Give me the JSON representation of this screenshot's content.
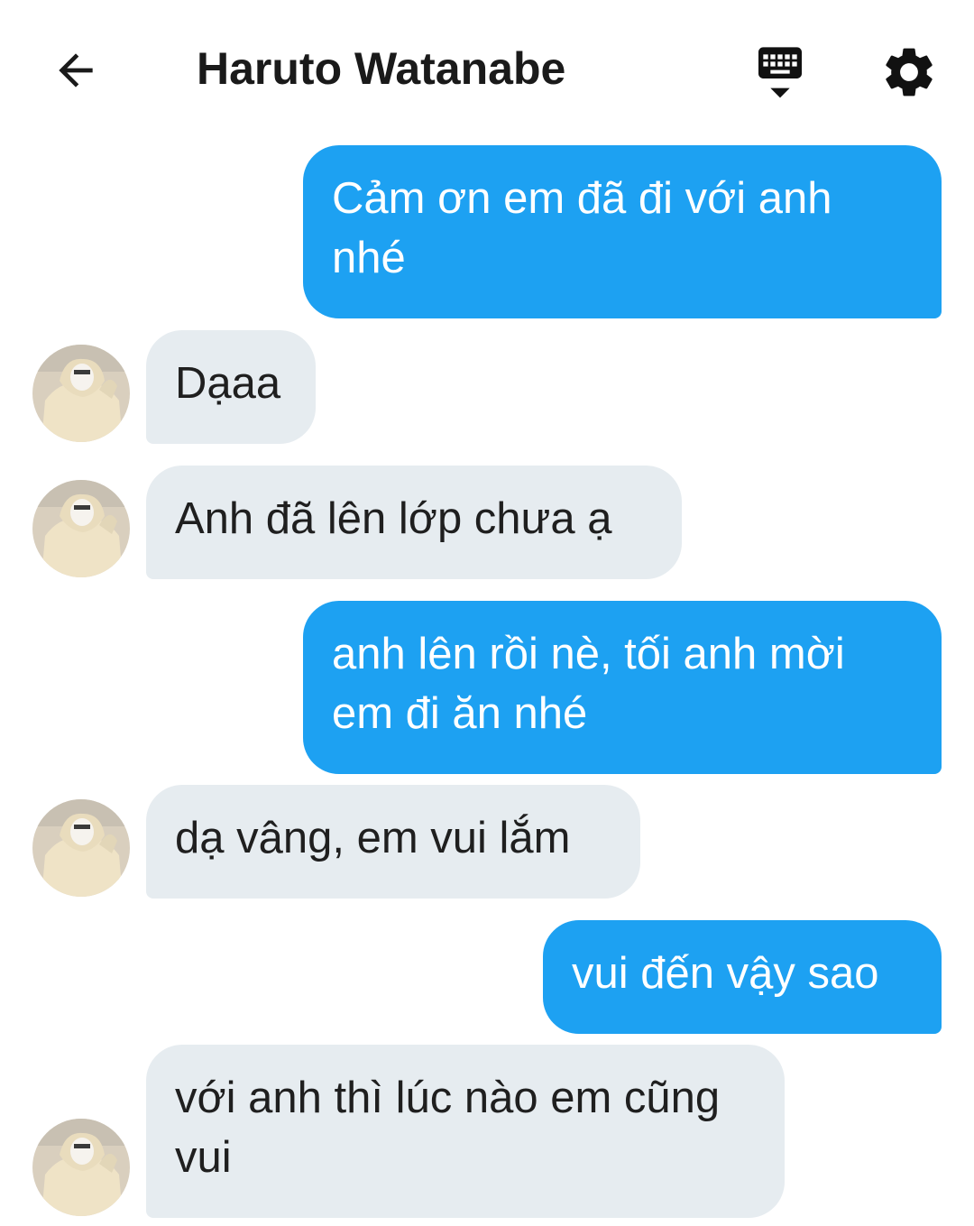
{
  "header": {
    "title": "Haruto Watanabe",
    "icons": {
      "back": "arrow-left-icon",
      "keyboard": "keyboard-icon",
      "settings": "gear-icon"
    }
  },
  "colors": {
    "outgoing_bubble": "#1da1f2",
    "incoming_bubble": "#e6ecf0",
    "outgoing_text": "#ffffff",
    "incoming_text": "#1f1f1f"
  },
  "messages": [
    {
      "direction": "out",
      "text": "Cảm ơn em đã đi với anh nhé"
    },
    {
      "direction": "in",
      "text": "Dạaa"
    },
    {
      "direction": "in",
      "text": "Anh đã lên lớp chưa ạ"
    },
    {
      "direction": "out",
      "text": "anh lên rồi nè, tối anh mời em đi ăn nhé"
    },
    {
      "direction": "in",
      "text": "dạ vâng, em vui lắm"
    },
    {
      "direction": "out",
      "text": "vui đến vậy sao"
    },
    {
      "direction": "in",
      "text": "với anh thì lúc nào em cũng vui"
    }
  ]
}
